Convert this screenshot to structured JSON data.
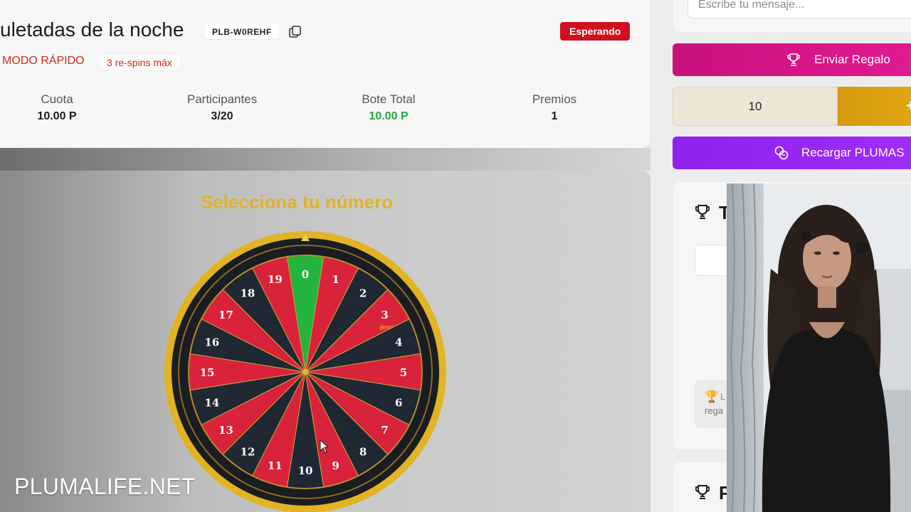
{
  "room": {
    "title": "uletadas de la noche",
    "code": "PLB-W0REHF",
    "status": "Esperando",
    "mode": "MODO RÁPIDO",
    "respins": "3 re-spins máx"
  },
  "stats": [
    {
      "label": "Cuota",
      "value": "10.00 P"
    },
    {
      "label": "Participantes",
      "value": "3/20"
    },
    {
      "label": "Bote Total",
      "value": "10.00 P"
    },
    {
      "label": "Premios",
      "value": "1"
    }
  ],
  "game": {
    "title": "Selecciona tu número",
    "wheel": {
      "numbers": [
        "0",
        "1",
        "2",
        "3",
        "4",
        "5",
        "6",
        "7",
        "8",
        "9",
        "10",
        "11",
        "12",
        "13",
        "14",
        "15",
        "16",
        "17",
        "18",
        "19"
      ],
      "taken": [
        {
          "number": "3",
          "player": "jenni"
        }
      ],
      "colors": {
        "zero": "#22b43c",
        "red": "#d9233a",
        "dark": "#1f2833",
        "rim": "#e2b424"
      }
    }
  },
  "watermark": "PLUMALIFE.NET",
  "sidebar": {
    "message_placeholder": "Escribe tu mensaje...",
    "gift_label": "Enviar Regalo",
    "amount_value": "10",
    "amount_button_label": "+",
    "recharge_label": "Recargar PLUMAS",
    "prize_card_title": "T",
    "note_l": "L",
    "note_text": "rega",
    "second_card_title": "P"
  },
  "icons": [
    "copy-icon",
    "trophy-icon",
    "coins-icon",
    "cursor-icon"
  ],
  "colors": {
    "accent_pink": "#d4168a",
    "accent_purple": "#9727f4",
    "accent_gold": "#d99f10",
    "status_red": "#d0101e",
    "green": "#22a83a"
  }
}
